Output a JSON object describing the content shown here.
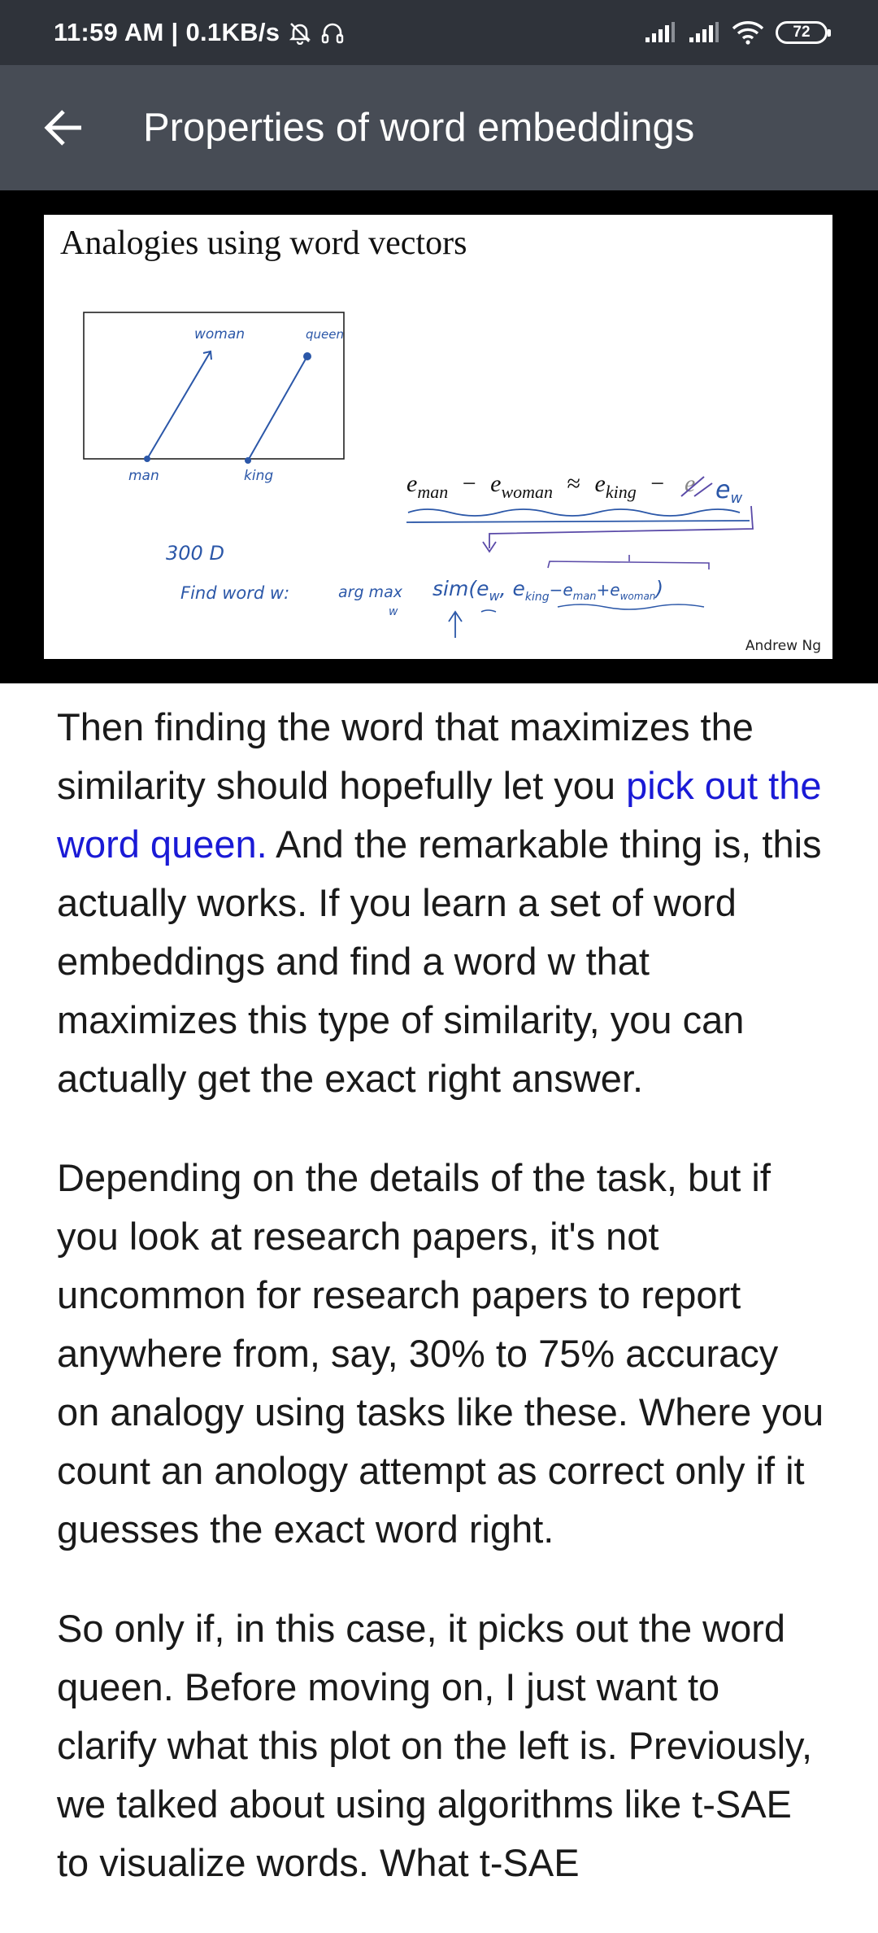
{
  "status_bar": {
    "time_and_speed": "11:59 AM | 0.1KB/s",
    "icons": [
      "mute-alarm-icon",
      "headset-icon",
      "signal-icon",
      "signal-icon",
      "wifi-icon"
    ],
    "battery_level": "72"
  },
  "app_bar": {
    "back_icon": "arrow-left-icon",
    "title": "Properties of word embeddings"
  },
  "slide": {
    "title": "Analogies using word vectors",
    "plot_labels": {
      "woman": "woman",
      "queen": "queen",
      "man": "man",
      "king": "king",
      "dimension": "300 D"
    },
    "equation": {
      "e1": "e",
      "s1": "man",
      "minus1": "−",
      "e2": "e",
      "s2": "woman",
      "approx": "≈",
      "e3": "e",
      "s3": "king",
      "minus2": "−",
      "e4": "e",
      "s4": "w"
    },
    "handwriting": {
      "find_word": "Find word w:",
      "argmax": "arg max",
      "argmax_sub": "w",
      "sim": "sim(e",
      "sim_sub": "w",
      "sim_rest": ", e",
      "king_sub": "king",
      "rest": "−e",
      "man_sub": "man",
      "plus": "+e",
      "woman_sub": "woman",
      "close": ")"
    },
    "credit": "Andrew Ng"
  },
  "transcript": {
    "p1_before": "Then finding the word that maximizes the similarity should hopefully let you ",
    "p1_highlight": "pick out the word queen.",
    "p1_after": " And the remarkable thing is, this actually works. If you learn a set of word embeddings and find a word w that maximizes this type of similarity, you can actually get the exact right answer.",
    "p2": "Depending on the details of the task, but if you look at research papers, it's not uncommon for research papers to report anywhere from, say, 30% to 75% accuracy on analogy using tasks like these. Where you count an anology attempt as correct only if it guesses the exact word right.",
    "p3": "So only if, in this case, it picks out the word queen. Before moving on, I just want to clarify what this plot on the left is. Previously, we talked about using algorithms like t-SAE to visualize words. What t-SAE"
  },
  "colors": {
    "status_bar_bg": "#2f333a",
    "app_bar_bg": "#474c55",
    "highlight_text": "#1a1ad6",
    "ink_blue": "#2b57a8",
    "ink_purple": "#5a4aa8"
  }
}
